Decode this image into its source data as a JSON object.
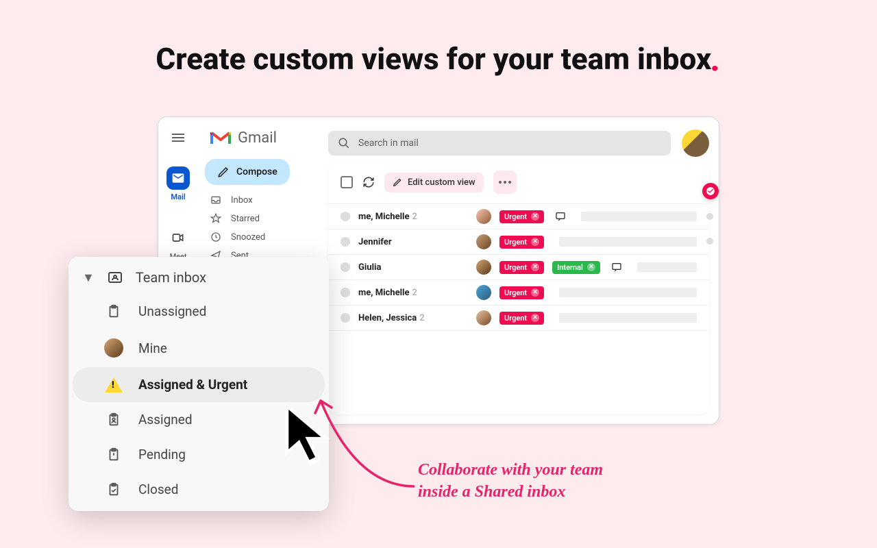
{
  "headline": "Create custom views for your team inbox",
  "app": {
    "name": "Gmail"
  },
  "rail": {
    "mail": "Mail",
    "meet": "Meet"
  },
  "compose_label": "Compose",
  "nav": {
    "inbox": "Inbox",
    "starred": "Starred",
    "snoozed": "Snoozed",
    "sent": "Sent"
  },
  "search": {
    "placeholder": "Search in mail"
  },
  "toolbar": {
    "edit": "Edit custom view"
  },
  "tags": {
    "urgent": "Urgent",
    "internal": "Internal"
  },
  "messages": [
    {
      "sender": "me, Michelle",
      "count": "2"
    },
    {
      "sender": "Jennifer",
      "count": ""
    },
    {
      "sender": "Giulia",
      "count": ""
    },
    {
      "sender": "me, Michelle",
      "count": "2"
    },
    {
      "sender": "Helen, Jessica",
      "count": "2"
    }
  ],
  "popover": {
    "header": "Team inbox",
    "items": {
      "unassigned": "Unassigned",
      "mine": "Mine",
      "assigned_urgent": "Assigned & Urgent",
      "assigned": "Assigned",
      "pending": "Pending",
      "closed": "Closed"
    }
  },
  "annotation": {
    "line1": "Collaborate with your team",
    "line2": "inside a Shared inbox"
  },
  "colors": {
    "accent": "#ed0d50",
    "primary": "#0b57d0"
  }
}
